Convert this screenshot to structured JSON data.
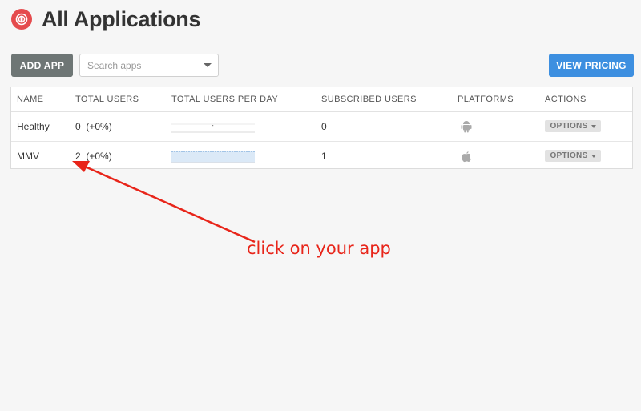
{
  "header": {
    "title": "All Applications",
    "logo_icon": "onesignal-logo-icon"
  },
  "toolbar": {
    "add_app_label": "ADD APP",
    "search_placeholder": "Search apps",
    "view_pricing_label": "VIEW PRICING"
  },
  "table": {
    "columns": [
      "NAME",
      "TOTAL USERS",
      "TOTAL USERS PER DAY",
      "SUBSCRIBED USERS",
      "PLATFORMS",
      "ACTIONS"
    ],
    "rows": [
      {
        "name": "Healthy",
        "total_users": "0",
        "total_users_change": "(+0%)",
        "subscribed": "0",
        "platform": "android-icon",
        "options_label": "OPTIONS"
      },
      {
        "name": "MMV",
        "total_users": "2",
        "total_users_change": "(+0%)",
        "subscribed": "1",
        "platform": "apple-icon",
        "options_label": "OPTIONS"
      }
    ]
  },
  "annotation": {
    "text": "click on your app"
  },
  "colors": {
    "accent_blue": "#3d8fe0",
    "add_app_gray": "#6e7675",
    "logo_red": "#e54b4d",
    "annotation_red": "#e8251a"
  }
}
